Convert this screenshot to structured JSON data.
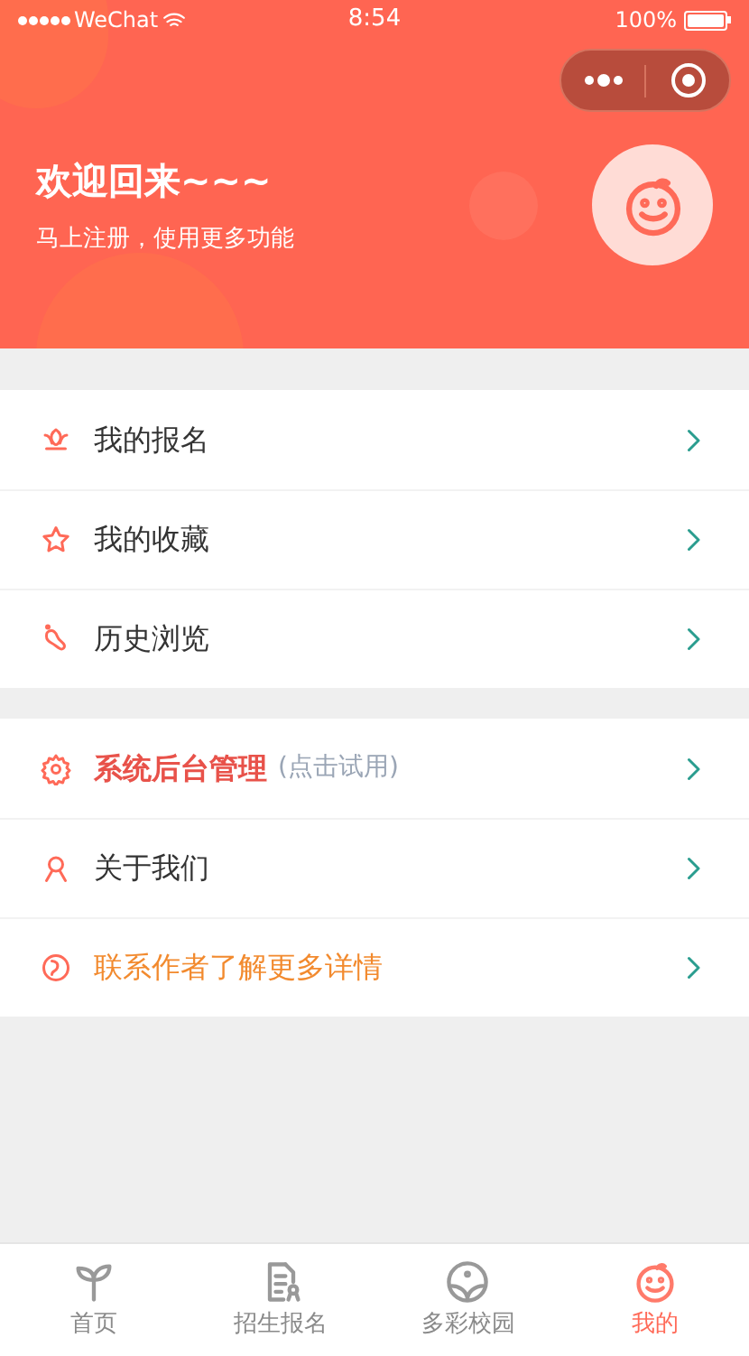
{
  "status_bar": {
    "carrier": "WeChat",
    "time": "8:54",
    "battery": "100%"
  },
  "header": {
    "title": "欢迎回来~~~",
    "subtitle": "马上注册，使用更多功能"
  },
  "menu_groups": [
    {
      "items": [
        {
          "kind": "normal",
          "label": "我的报名"
        },
        {
          "kind": "normal",
          "label": "我的收藏"
        },
        {
          "kind": "normal",
          "label": "历史浏览"
        }
      ]
    },
    {
      "items": [
        {
          "kind": "highlight",
          "label": "系统后台管理",
          "note": "(点击试用)"
        },
        {
          "kind": "normal",
          "label": "关于我们"
        },
        {
          "kind": "accent",
          "label": "联系作者了解更多详情"
        }
      ]
    }
  ],
  "tab_bar": [
    {
      "label": "首页",
      "selected": false
    },
    {
      "label": "招生报名",
      "selected": false
    },
    {
      "label": "多彩校园",
      "selected": false
    },
    {
      "label": "我的",
      "selected": true
    }
  ]
}
